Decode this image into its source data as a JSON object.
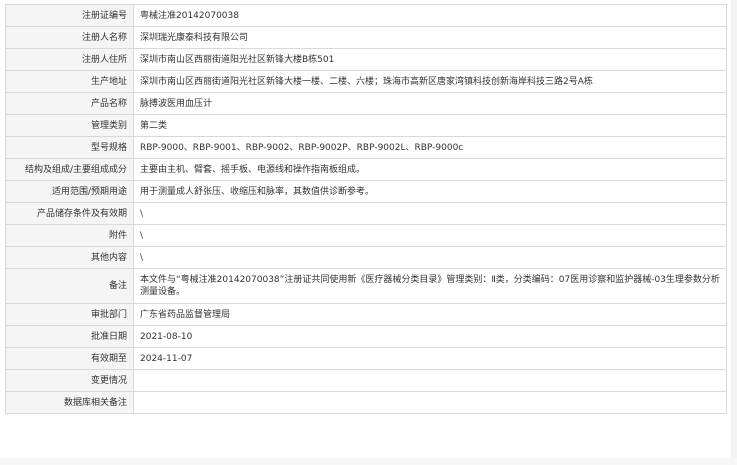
{
  "rows": [
    {
      "label": "注册证编号",
      "value": "粤械注准20142070038"
    },
    {
      "label": "注册人名称",
      "value": "深圳瑞光康泰科技有限公司"
    },
    {
      "label": "注册人住所",
      "value": "深圳市南山区西丽街道阳光社区新锋大楼B栋501"
    },
    {
      "label": "生产地址",
      "value": "深圳市南山区西丽街道阳光社区新锋大楼一楼、二楼、六楼；珠海市高新区唐家湾镇科技创新海岸科技三路2号A栋"
    },
    {
      "label": "产品名称",
      "value": "脉搏波医用血压计"
    },
    {
      "label": "管理类别",
      "value": "第二类"
    },
    {
      "label": "型号规格",
      "value": "RBP-9000、RBP-9001、RBP-9002、RBP-9002P、RBP-9002L、RBP-9000c"
    },
    {
      "label": "结构及组成/主要组成成分",
      "value": "主要由主机、臂套、摇手板、电源线和操作指南板组成。"
    },
    {
      "label": "适用范围/预期用途",
      "value": "用于测量成人舒张压、收缩压和脉率，其数值供诊断参考。"
    },
    {
      "label": "产品储存条件及有效期",
      "value": "\\"
    },
    {
      "label": "附件",
      "value": "\\"
    },
    {
      "label": "其他内容",
      "value": "\\"
    },
    {
      "label": "备注",
      "value": "本文件与“粤械注准20142070038”注册证共同使用新《医疗器械分类目录》管理类别：Ⅱ类，分类编码：07医用诊察和监护器械-03生理参数分析测量设备。"
    },
    {
      "label": "审批部门",
      "value": "广东省药品监督管理局"
    },
    {
      "label": "批准日期",
      "value": "2021-08-10"
    },
    {
      "label": "有效期至",
      "value": "2024-11-07"
    },
    {
      "label": "变更情况",
      "value": ""
    },
    {
      "label": "数据库相关备注",
      "value": ""
    }
  ]
}
